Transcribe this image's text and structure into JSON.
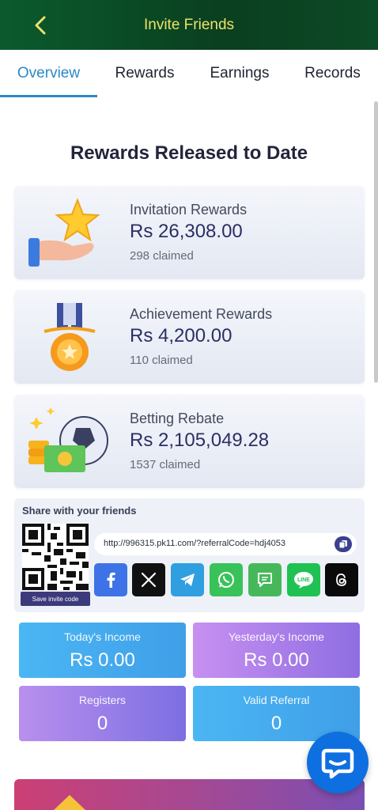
{
  "header": {
    "title": "Invite Friends"
  },
  "tabs": [
    {
      "label": "Overview",
      "active": true
    },
    {
      "label": "Rewards"
    },
    {
      "label": "Earnings"
    },
    {
      "label": "Records"
    }
  ],
  "heading": "Rewards Released to Date",
  "rewards": [
    {
      "name": "Invitation Rewards",
      "amount": "Rs 26,308.00",
      "claimed": "298 claimed",
      "icon": "star-hand-icon"
    },
    {
      "name": "Achievement Rewards",
      "amount": "Rs 4,200.00",
      "claimed": "110 claimed",
      "icon": "medal-icon"
    },
    {
      "name": "Betting Rebate",
      "amount": "Rs 2,105,049.28",
      "claimed": "1537 claimed",
      "icon": "coins-ball-icon"
    }
  ],
  "share": {
    "label": "Share with your friends",
    "save_label": "Save invite code",
    "url": "http://996315.pk11.com/?referralCode=hdj4053",
    "socials": [
      "facebook",
      "x",
      "telegram",
      "whatsapp",
      "sms",
      "line",
      "threads"
    ]
  },
  "stats": {
    "today": {
      "label": "Today's Income",
      "value": "Rs 0.00"
    },
    "yesterday": {
      "label": "Yesterday's Income",
      "value": "Rs 0.00"
    },
    "registers": {
      "label": "Registers",
      "value": "0"
    },
    "valid": {
      "label": "Valid Referral",
      "value": "0"
    }
  },
  "colors": {
    "accent": "#2b88c8",
    "header_text": "#ece36a",
    "header_bg": "#0a3f1f"
  }
}
